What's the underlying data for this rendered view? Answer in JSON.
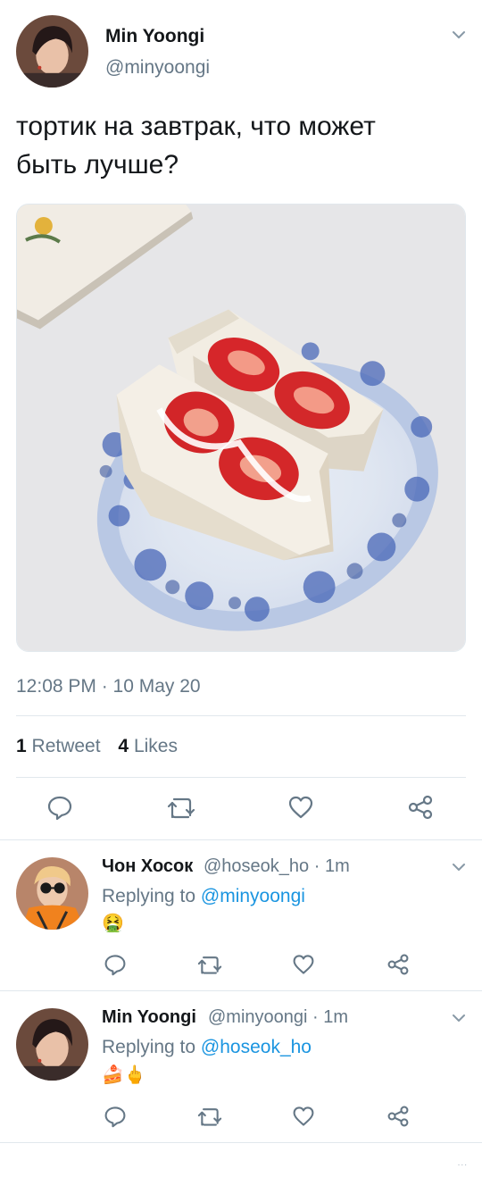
{
  "main_tweet": {
    "author_name": "Min Yoongi",
    "author_handle": "@minyoongi",
    "text_line1": "тортик на завтрак, что может",
    "text_line2": "быть лучше?",
    "timestamp": "12:08 PM · 10 May 20",
    "retweet_count": "1",
    "retweet_label": "Retweet",
    "like_count": "4",
    "like_label": "Likes"
  },
  "replies": [
    {
      "author_name": "Чон Хосок",
      "author_handle": "@hoseok_ho",
      "time": "· 1m",
      "replying_prefix": "Replying to",
      "replying_to": "@minyoongi",
      "content": "🤮"
    },
    {
      "author_name": "Min Yoongi",
      "author_handle": "@minyoongi",
      "time": "· 1m",
      "replying_prefix": "Replying to",
      "replying_to": "@hoseok_ho",
      "content": "🍰🖕"
    }
  ],
  "more_indicator": "...",
  "colors": {
    "link": "#1b95e0",
    "secondary_text": "#657786",
    "primary_text": "#14171a",
    "divider": "#e1e8ed"
  },
  "icons": [
    "chevron-down-icon",
    "reply-icon",
    "retweet-icon",
    "like-icon",
    "share-icon"
  ]
}
